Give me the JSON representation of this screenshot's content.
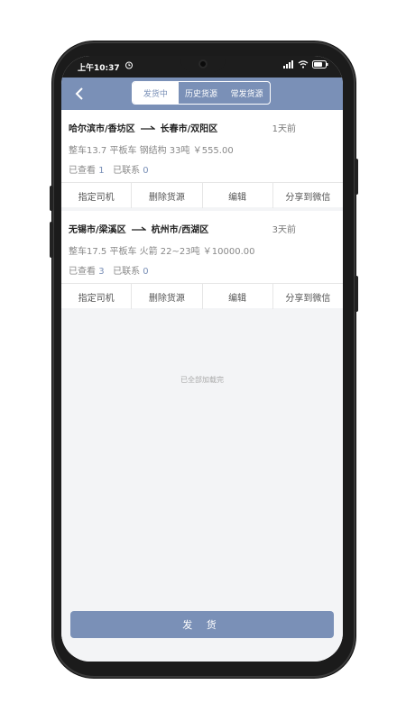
{
  "status_bar": {
    "time": "上午10:37",
    "alarm_icon": "alarm-icon",
    "signal_icon": "signal-icon",
    "wifi_icon": "wifi-icon",
    "battery_icon": "battery-icon"
  },
  "navbar": {
    "tabs": [
      {
        "label": "发货中",
        "active": true
      },
      {
        "label": "历史货源",
        "active": false
      },
      {
        "label": "常发货源",
        "active": false
      }
    ],
    "accent_color": "#7a90b7"
  },
  "cards": [
    {
      "from": "哈尔滨市/香坊区",
      "to": "长春市/双阳区",
      "ago": "1天前",
      "detail": "整车13.7 平板车 钢结构 33吨 ￥555.00",
      "viewed_label": "已查看",
      "viewed": "1",
      "contacted_label": "已联系",
      "contacted": "0",
      "actions": [
        "指定司机",
        "删除货源",
        "编辑",
        "分享到微信"
      ]
    },
    {
      "from": "无锡市/梁溪区",
      "to": "杭州市/西湖区",
      "ago": "3天前",
      "detail": "整车17.5 平板车 火箭 22~23吨 ￥10000.00",
      "viewed_label": "已查看",
      "viewed": "3",
      "contacted_label": "已联系",
      "contacted": "0",
      "actions": [
        "指定司机",
        "删除货源",
        "编辑",
        "分享到微信"
      ]
    }
  ],
  "end_note": "已全部加载完",
  "post_button": "发 货"
}
